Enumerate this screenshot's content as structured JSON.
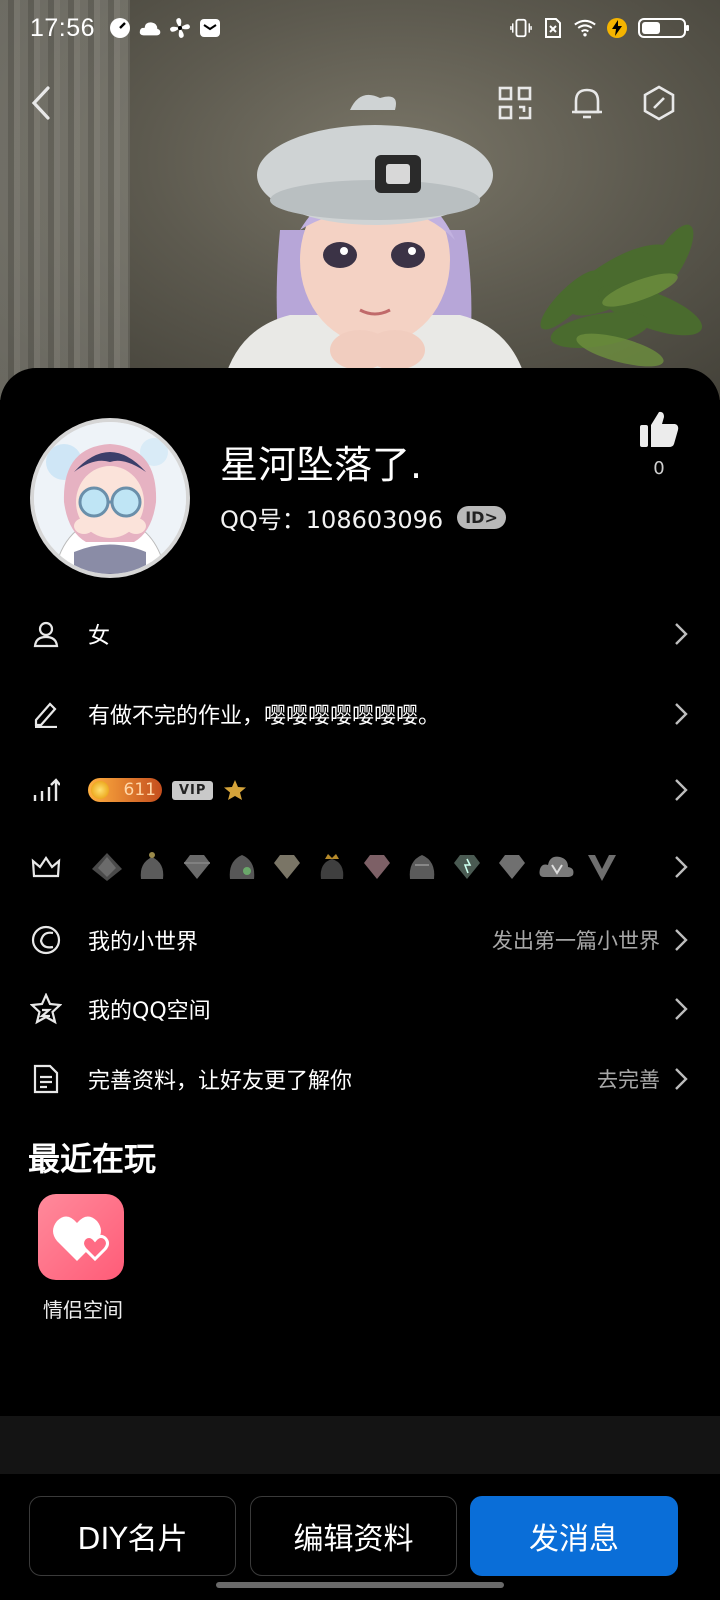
{
  "status_bar": {
    "time": "17:56",
    "left_icons": [
      "speed-icon",
      "cloud-icon",
      "fan-icon",
      "mail-icon"
    ],
    "right_icons": [
      "vibrate-icon",
      "no-sim-icon",
      "wifi-icon",
      "charging-icon",
      "battery-icon"
    ]
  },
  "top_nav": {
    "icons": [
      "back-icon",
      "qr-code-icon",
      "bell-icon",
      "settings-hex-icon"
    ]
  },
  "profile": {
    "nickname": "星河坠落了.",
    "qq_label": "QQ号：108603096",
    "id_badge": "ID>",
    "like_count": "0"
  },
  "rows": [
    {
      "icon": "person-icon",
      "text": "女",
      "hint": ""
    },
    {
      "icon": "pencil-icon",
      "text": "有做不完的作业，嘤嘤嘤嘤嘤嘤嘤。",
      "hint": ""
    },
    {
      "icon": "level-chart-icon",
      "level": "611",
      "vip": "VIP"
    },
    {
      "icon": "crown-icon",
      "badges": 12
    },
    {
      "icon": "world-icon",
      "text": "我的小世界",
      "hint": "发出第一篇小世界"
    },
    {
      "icon": "star-badge-icon",
      "text": "我的QQ空间",
      "hint": ""
    },
    {
      "icon": "document-icon",
      "text": "完善资料，让好友更了解你",
      "hint": "去完善"
    }
  ],
  "recent": {
    "title": "最近在玩",
    "apps": [
      {
        "label": "情侣空间",
        "icon": "couple-space-heart-icon"
      }
    ]
  },
  "bottom": {
    "diy": "DIY名片",
    "edit": "编辑资料",
    "message": "发消息"
  },
  "colors": {
    "primary": "#0a6ed8",
    "app_pink": "#ff6b84",
    "background": "#000000"
  }
}
